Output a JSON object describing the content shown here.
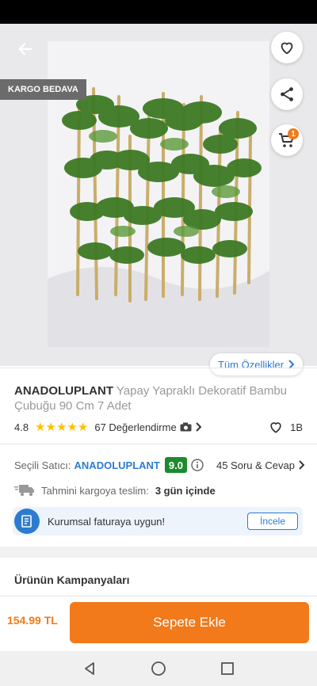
{
  "product": {
    "brand": "ANADOLUPLANT",
    "name": "Yapay Yapraklı Dekoratif Bambu Çubuğu 90 Cm 7 Adet",
    "badge": "KARGO BEDAVA",
    "all_features_label": "Tüm Özellikler",
    "cart_count": "1",
    "rating": 4.8,
    "rating_text": "4.8",
    "stars_filled": 5,
    "reviews_label": "67 Değerlendirme",
    "favorites_count": "1B"
  },
  "seller": {
    "label": "Seçili Satıcı:",
    "name": "ANADOLUPLANT",
    "score": "9.0",
    "qa_label": "45 Soru & Cevap"
  },
  "delivery": {
    "label": "Tahmini kargoya teslim:",
    "value": "3 gün içinde"
  },
  "invoice": {
    "text": "Kurumsal faturaya uygun!",
    "button": "İncele"
  },
  "campaigns": {
    "title": "Ürünün Kampanyaları"
  },
  "bottom": {
    "price": "154.99 TL",
    "add_to_cart": "Sepete Ekle"
  },
  "icons": {
    "back": "arrow-left-icon",
    "favorite": "heart-icon",
    "share": "share-icon",
    "cart": "cart-icon",
    "camera": "camera-icon",
    "info": "info-icon",
    "truck": "truck-icon",
    "invoice": "invoice-icon"
  },
  "colors": {
    "accent": "#f27a1a",
    "link": "#2c7bd1",
    "seller_score": "#1c8a2e",
    "star": "#ffc000"
  }
}
